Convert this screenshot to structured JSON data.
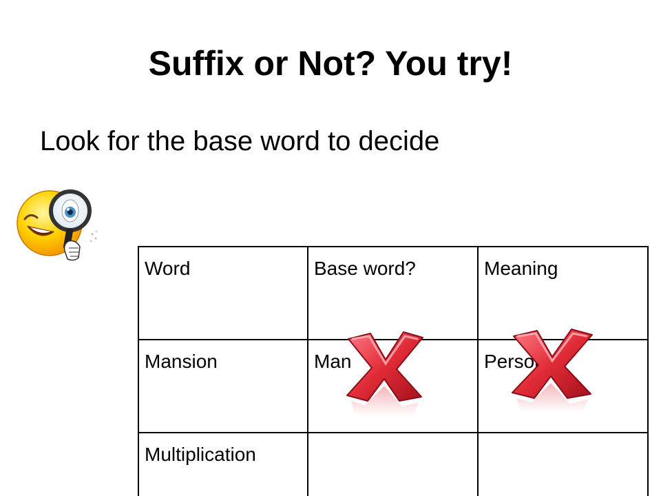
{
  "slide": {
    "title": "Suffix or Not? You try!",
    "subtitle": "Look for the base word to decide"
  },
  "table": {
    "headers": [
      "Word",
      "Base word?",
      "Meaning"
    ],
    "rows": [
      [
        "Mansion",
        "Man",
        "Person"
      ],
      [
        "Multiplication",
        "",
        ""
      ]
    ]
  },
  "icons": {
    "smiley": "smiley-magnifier-icon",
    "cross": "red-x-icon"
  },
  "colors": {
    "cross_red": "#e02b37",
    "smiley_yellow": "#ffcc00",
    "magnifier_blue": "#4a90c8"
  }
}
